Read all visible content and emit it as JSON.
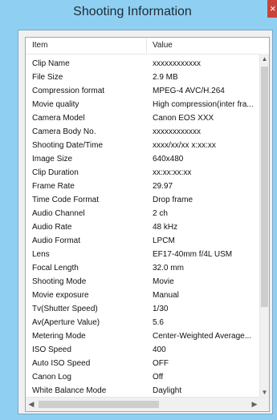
{
  "window": {
    "title": "Shooting Information",
    "close_label": "×"
  },
  "list": {
    "columns": {
      "item": "Item",
      "value": "Value"
    },
    "rows": [
      {
        "k": "Clip Name",
        "v": "xxxxxxxxxxxx"
      },
      {
        "k": "File Size",
        "v": "2.9 MB"
      },
      {
        "k": "Compression format",
        "v": "MPEG-4 AVC/H.264"
      },
      {
        "k": "Movie quality",
        "v": "High compression(inter fra..."
      },
      {
        "k": "Camera Model",
        "v": "Canon EOS XXX"
      },
      {
        "k": "Camera Body No.",
        "v": "xxxxxxxxxxxx"
      },
      {
        "k": "Shooting Date/Time",
        "v": "xxxx/xx/xx  x:xx:xx"
      },
      {
        "k": "Image Size",
        "v": "640x480"
      },
      {
        "k": "Clip Duration",
        "v": "xx:xx:xx:xx"
      },
      {
        "k": "Frame Rate",
        "v": "29.97"
      },
      {
        "k": "Time Code Format",
        "v": "Drop frame"
      },
      {
        "k": "Audio Channel",
        "v": "2 ch"
      },
      {
        "k": "Audio Rate",
        "v": "48 kHz"
      },
      {
        "k": "Audio Format",
        "v": "LPCM"
      },
      {
        "k": "Lens",
        "v": "EF17-40mm f/4L USM"
      },
      {
        "k": "Focal Length",
        "v": "32.0 mm"
      },
      {
        "k": "Shooting Mode",
        "v": "Movie"
      },
      {
        "k": "Movie exposure",
        "v": "Manual"
      },
      {
        "k": "Tv(Shutter Speed)",
        "v": "1/30"
      },
      {
        "k": "Av(Aperture Value)",
        "v": "5.6"
      },
      {
        "k": "Metering Mode",
        "v": "Center-Weighted Average..."
      },
      {
        "k": "ISO Speed",
        "v": "400"
      },
      {
        "k": "Auto ISO Speed",
        "v": "OFF"
      },
      {
        "k": "Canon Log",
        "v": "Off"
      },
      {
        "k": "White Balance Mode",
        "v": "Daylight"
      }
    ]
  },
  "scroll": {
    "up_icon": "up-arrow",
    "down_icon": "down-arrow",
    "left_icon": "left-arrow",
    "right_icon": "right-arrow",
    "up_glyph": "▲",
    "down_glyph": "▼",
    "left_glyph": "◀",
    "right_glyph": "▶"
  },
  "colors": {
    "window_frame": "#8fd0f2",
    "close_button": "#c9433a",
    "client_bg": "#f0f0f0"
  }
}
